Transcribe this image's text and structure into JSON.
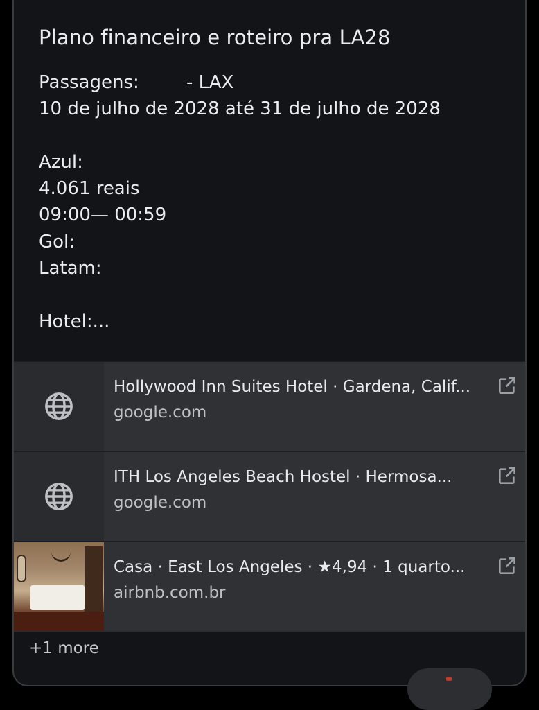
{
  "note": {
    "title": "Plano financeiro e roteiro pra LA28",
    "lines": [
      "Passagens:",
      "10 de julho de 2028 até 31 de julho de 2028",
      "",
      "Azul:",
      "4.061 reais",
      "09:00— 00:59",
      "Gol:",
      "Latam:",
      "",
      "Hotel:..."
    ],
    "passagens_suffix": "- LAX"
  },
  "links": [
    {
      "title": "Hollywood Inn Suites Hotel · Gardena, Calif...",
      "domain": "google.com",
      "thumb": "globe-icon"
    },
    {
      "title": "ITH Los Angeles Beach Hostel · Hermosa...",
      "domain": "google.com",
      "thumb": "globe-icon"
    },
    {
      "title": "Casa · East Los Angeles · ★4,94 · 1 quarto...",
      "domain": "airbnb.com.br",
      "thumb": "photo"
    }
  ],
  "more_label": "+1 more",
  "icons": {
    "open": "open-in-new-icon",
    "globe": "globe-icon"
  },
  "colors": {
    "card_bg": "#131418",
    "link_row_bg": "#303134",
    "text": "#ececef",
    "secondary_text": "#bdc1c6"
  }
}
